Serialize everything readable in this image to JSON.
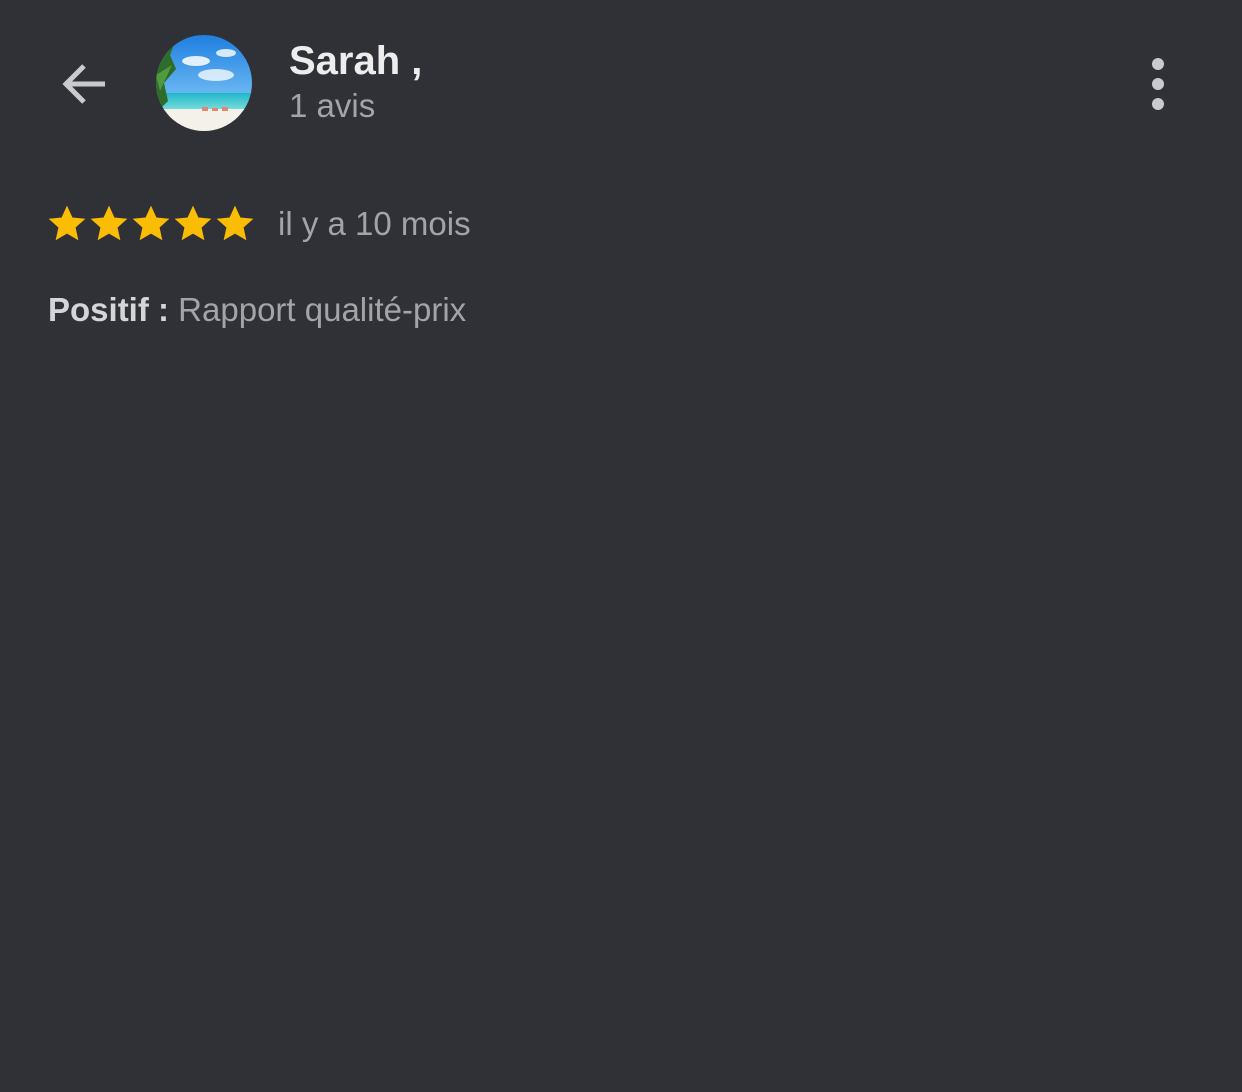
{
  "header": {
    "user_name": "Sarah ,",
    "review_count": "1 avis",
    "avatar_icon": "beach-photo-avatar",
    "back_icon": "arrow-left-icon",
    "menu_icon": "more-vertical-icon"
  },
  "review": {
    "rating": 5,
    "max_rating": 5,
    "date": "il y a 10 mois",
    "positive_label": "Positif :",
    "positive_text": "Rapport qualité-prix"
  },
  "colors": {
    "background": "#303136",
    "star": "#fbbc04",
    "primary_text": "#ededee",
    "secondary_text": "#a3a4a8"
  }
}
